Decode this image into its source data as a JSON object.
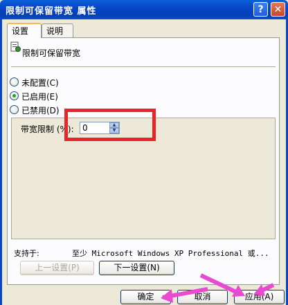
{
  "window": {
    "title": "限制可保留带宽 属性",
    "help_label": "?",
    "close_label": "✕"
  },
  "tabs": [
    {
      "label": "设置"
    },
    {
      "label": "说明"
    }
  ],
  "policy": {
    "name": "限制可保留带宽",
    "icon": "policy-setting-icon"
  },
  "radios": [
    {
      "label": "未配置(C)",
      "checked": false
    },
    {
      "label": "已启用(E)",
      "checked": true
    },
    {
      "label": "已禁用(D)",
      "checked": false
    }
  ],
  "option": {
    "label": "带宽限制 (%):",
    "value": "0"
  },
  "support": {
    "label": "支持于:",
    "text": "至少 Microsoft Windows XP Professional 或..."
  },
  "nav": {
    "prev_label": "上一设置(P)",
    "next_label": "下一设置(N)"
  },
  "footer": {
    "ok_label": "确定",
    "cancel_label": "取消",
    "apply_label": "应用(A)"
  },
  "colors": {
    "highlight": "#e8262a",
    "arrows": "#e64bd2",
    "titlebar": "#0846c7"
  }
}
